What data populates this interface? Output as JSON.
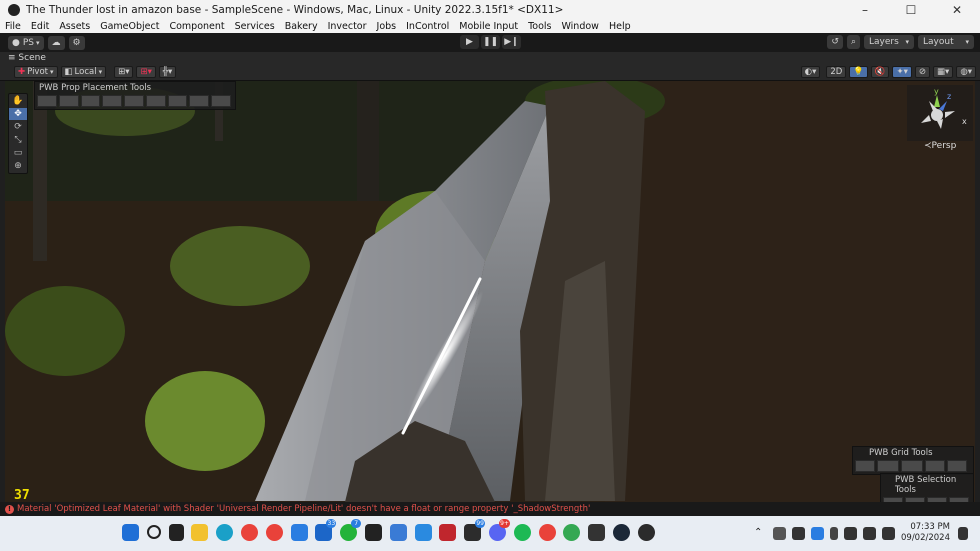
{
  "window": {
    "title": "The Thunder lost in amazon base - SampleScene - Windows, Mac, Linux - Unity 2022.3.15f1* <DX11>",
    "controls": [
      "–",
      "☐",
      "✕"
    ]
  },
  "menu": [
    "File",
    "Edit",
    "Assets",
    "GameObject",
    "Component",
    "Services",
    "Bakery",
    "Invector",
    "Jobs",
    "InControl",
    "Mobile Input",
    "Tools",
    "Window",
    "Help"
  ],
  "toolbar": {
    "account_label": "PS",
    "layers_label": "Layers",
    "layout_label": "Layout"
  },
  "scene": {
    "tab_label": "Scene",
    "pivot_label": "Pivot",
    "local_label": "Local",
    "mode_2d": "2D",
    "persp_label": "Persp",
    "gizmo_axes": {
      "y": "y",
      "x": "x",
      "z": "z"
    }
  },
  "pwb": {
    "prop_tools_title": "PWB Prop Placement Tools",
    "grid_tools_title": "PWB Grid Tools",
    "selection_tools_title": "PWB Selection Tools"
  },
  "fps_counter": "37",
  "console": {
    "message": "Material 'Optimized Leaf Material' with Shader 'Universal Render Pipeline/Lit' doesn't have a float or range property '_ShadowStrength'",
    "color": "#e0514b"
  },
  "taskbar": {
    "badges": {
      "mail": "33",
      "whatsapp": "7",
      "blender": "99",
      "discord": "9+"
    },
    "time": "07:33 PM",
    "date": "09/02/2024"
  }
}
